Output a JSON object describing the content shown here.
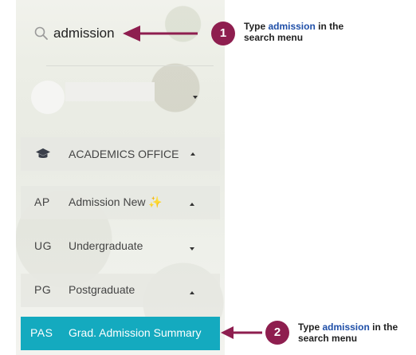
{
  "search": {
    "value": "admission"
  },
  "menu": {
    "header": {
      "label": "ACADEMICS OFFICE"
    },
    "items": [
      {
        "abbr": "AP",
        "label": "Admission New ✨"
      },
      {
        "abbr": "UG",
        "label": "Undergraduate"
      },
      {
        "abbr": "PG",
        "label": "Postgraduate"
      }
    ],
    "active_item": {
      "abbr": "PAS",
      "label": "Grad. Admission Summary"
    }
  },
  "callouts": [
    {
      "number": "1",
      "prefix": "Type ",
      "keyword": "admission",
      "suffix": " in the",
      "line2": "search menu"
    },
    {
      "number": "2",
      "prefix": "Type ",
      "keyword": "admission",
      "suffix": " in the",
      "line2": "search menu"
    }
  ],
  "colors": {
    "accent": "#14aabf",
    "callout": "#8e1e4f",
    "keyword": "#1f4fa8"
  }
}
